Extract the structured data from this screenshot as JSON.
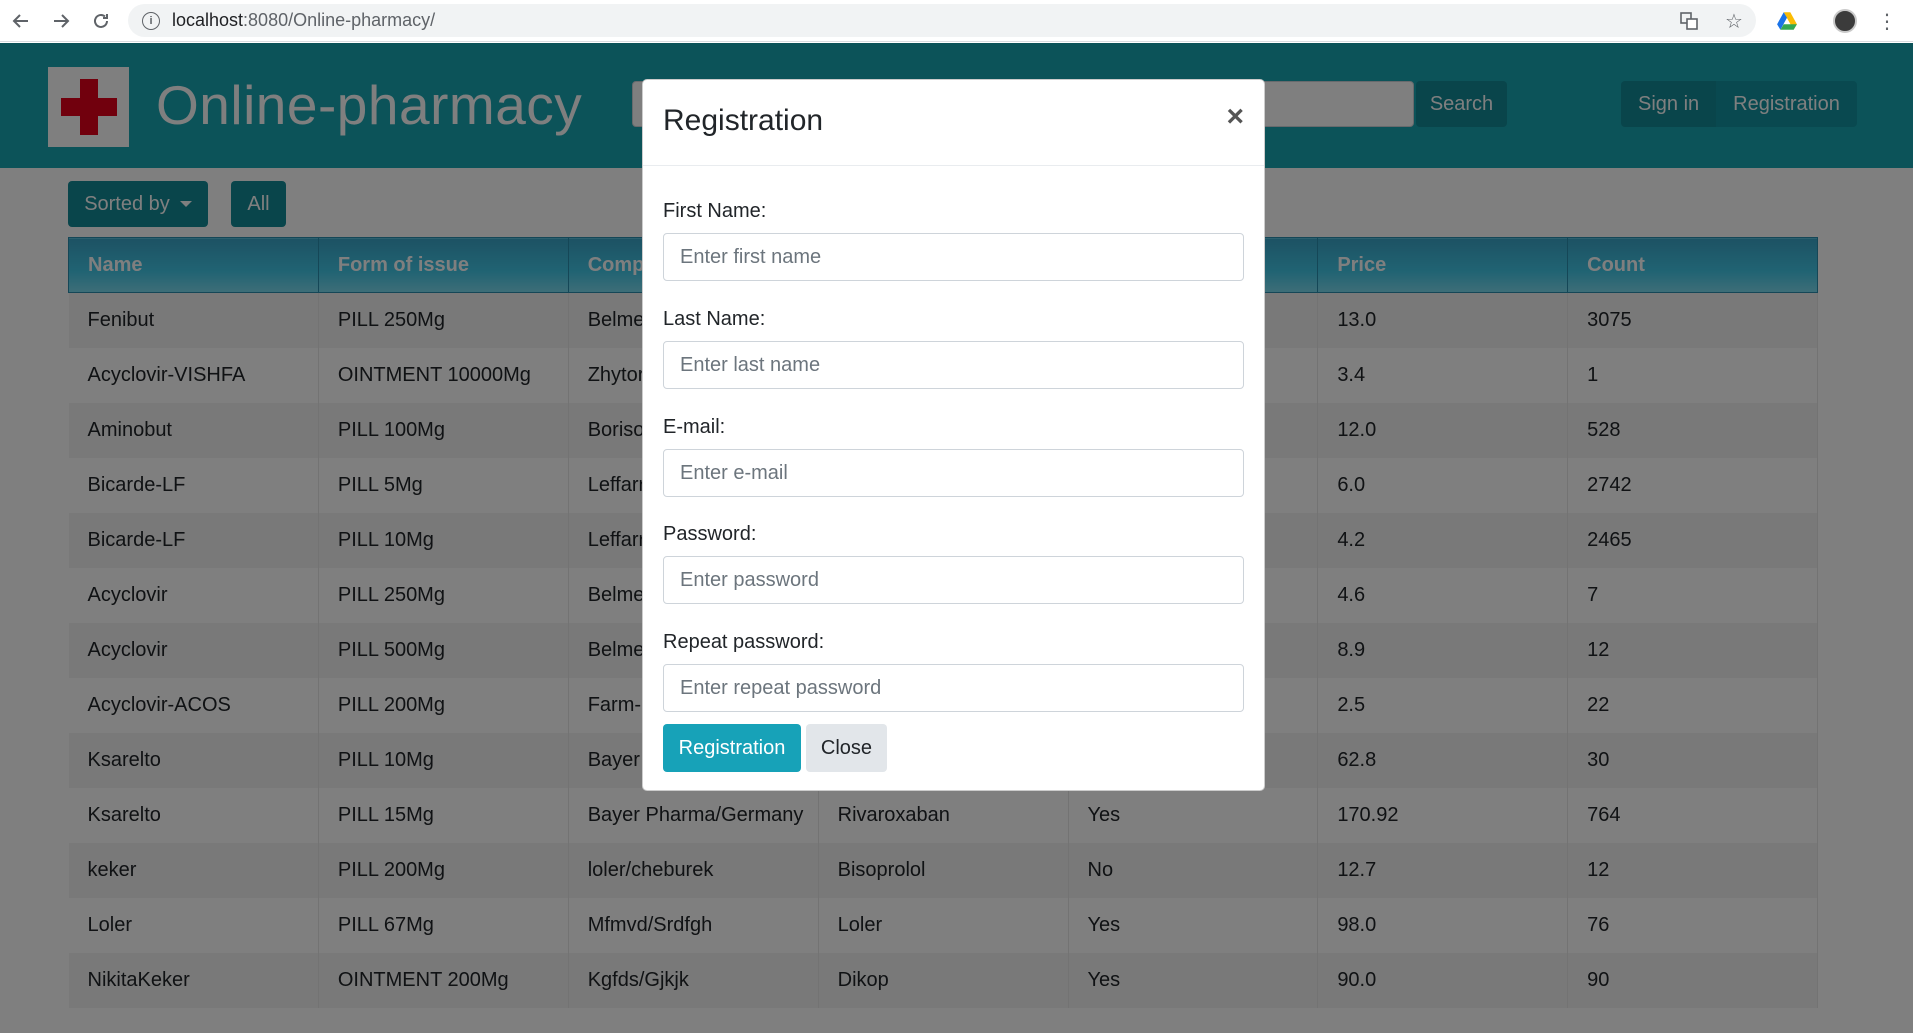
{
  "browser": {
    "url_host": "localhost",
    "url_path": ":8080/Online-pharmacy/"
  },
  "navbar": {
    "brand": "Online-pharmacy",
    "search_button": "Search",
    "sign_in": "Sign in",
    "registration": "Registration"
  },
  "toolbar": {
    "sorted_by": "Sorted by",
    "all": "All"
  },
  "table": {
    "headers": [
      "Name",
      "Form of issue",
      "Comp",
      "",
      "",
      "Price",
      "Count"
    ],
    "rows": [
      [
        "Fenibut",
        "PILL 250Mg",
        "Belme",
        "",
        "",
        "13.0",
        "3075"
      ],
      [
        "Acyclovir-VISHFA",
        "OINTMENT 10000Mg",
        "Zhytor",
        "",
        "",
        "3.4",
        "1"
      ],
      [
        "Aminobut",
        "PILL 100Mg",
        "Boriso",
        "",
        "",
        "12.0",
        "528"
      ],
      [
        "Bicarde-LF",
        "PILL 5Mg",
        "Leffarr",
        "",
        "",
        "6.0",
        "2742"
      ],
      [
        "Bicarde-LF",
        "PILL 10Mg",
        "Leffarr",
        "",
        "",
        "4.2",
        "2465"
      ],
      [
        "Acyclovir",
        "PILL 250Mg",
        "Belme",
        "",
        "",
        "4.6",
        "7"
      ],
      [
        "Acyclovir",
        "PILL 500Mg",
        "Belme",
        "",
        "",
        "8.9",
        "12"
      ],
      [
        "Acyclovir-ACOS",
        "PILL 200Mg",
        "Farm-",
        "",
        "",
        "2.5",
        "22"
      ],
      [
        "Ksarelto",
        "PILL 10Mg",
        "Bayer",
        "",
        "",
        "62.8",
        "30"
      ],
      [
        "Ksarelto",
        "PILL 15Mg",
        "Bayer Pharma/Germany",
        "Rivaroxaban",
        "Yes",
        "170.92",
        "764"
      ],
      [
        "keker",
        "PILL 200Mg",
        "loler/cheburek",
        "Bisoprolol",
        "No",
        "12.7",
        "12"
      ],
      [
        "Loler",
        "PILL 67Mg",
        "Mfmvd/Srdfgh",
        "Loler",
        "Yes",
        "98.0",
        "76"
      ],
      [
        "NikitaKeker",
        "OINTMENT 200Mg",
        "Kgfds/Gjkjk",
        "Dikop",
        "Yes",
        "90.0",
        "90"
      ]
    ]
  },
  "modal": {
    "title": "Registration",
    "close_symbol": "×",
    "first_name_label": "First Name:",
    "first_name_placeholder": "Enter first name",
    "last_name_label": "Last Name:",
    "last_name_placeholder": "Enter last name",
    "email_label": "E-mail:",
    "email_placeholder": "Enter e-mail",
    "password_label": "Password:",
    "password_placeholder": "Enter password",
    "repeat_password_label": "Repeat password:",
    "repeat_password_placeholder": "Enter repeat password",
    "submit_button": "Registration",
    "close_button": "Close"
  },
  "colors": {
    "brand_teal": "#18a6b3",
    "button_teal": "#138a96",
    "primary_button": "#17a2b8",
    "logo_cross": "#e3001b"
  },
  "icons": [
    "back-arrow-icon",
    "forward-arrow-icon",
    "reload-icon",
    "info-icon",
    "translate-icon",
    "star-icon",
    "drive-icon",
    "avatar",
    "menu-kebab-icon"
  ]
}
